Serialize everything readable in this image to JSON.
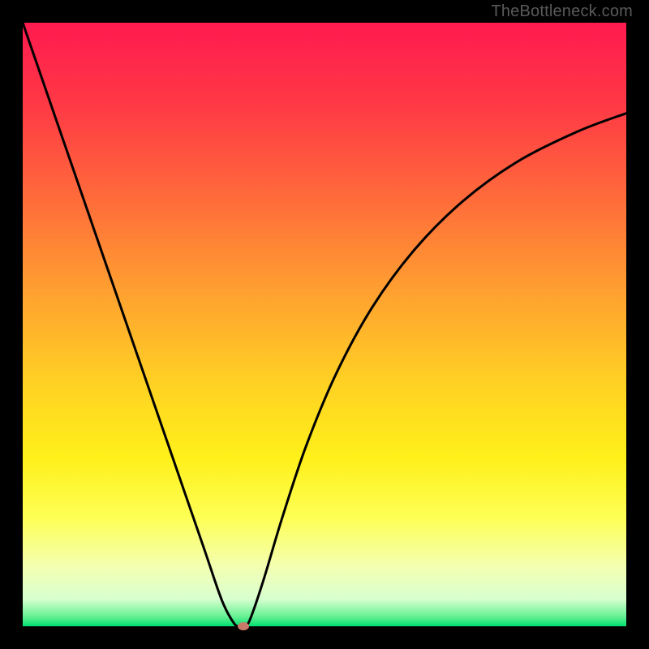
{
  "watermark": "TheBottleneck.com",
  "chart_data": {
    "type": "line",
    "title": "",
    "xlabel": "",
    "ylabel": "",
    "xlim": [
      0,
      100
    ],
    "ylim": [
      0,
      100
    ],
    "gradient_stops": [
      {
        "pos": 0.0,
        "color": "#ff1a4f"
      },
      {
        "pos": 0.14,
        "color": "#ff3a45"
      },
      {
        "pos": 0.3,
        "color": "#ff6e3a"
      },
      {
        "pos": 0.46,
        "color": "#ffa52f"
      },
      {
        "pos": 0.6,
        "color": "#ffd223"
      },
      {
        "pos": 0.72,
        "color": "#fff01a"
      },
      {
        "pos": 0.82,
        "color": "#feff55"
      },
      {
        "pos": 0.9,
        "color": "#f4ffb0"
      },
      {
        "pos": 0.955,
        "color": "#d8ffd0"
      },
      {
        "pos": 0.985,
        "color": "#60f090"
      },
      {
        "pos": 1.0,
        "color": "#00e070"
      }
    ],
    "series": [
      {
        "name": "bottleneck-curve",
        "x": [
          0,
          5,
          10,
          15,
          20,
          25,
          30,
          33,
          35,
          36,
          37,
          38,
          40,
          43,
          47,
          52,
          58,
          65,
          73,
          82,
          92,
          100
        ],
        "values": [
          100,
          85.5,
          71,
          56.5,
          42,
          27.5,
          13,
          4.3,
          0.5,
          0,
          0,
          2,
          8,
          18,
          30,
          42,
          53,
          62.5,
          70.5,
          77,
          82,
          85
        ]
      }
    ],
    "marker": {
      "x": 36.5,
      "y": 0
    }
  }
}
